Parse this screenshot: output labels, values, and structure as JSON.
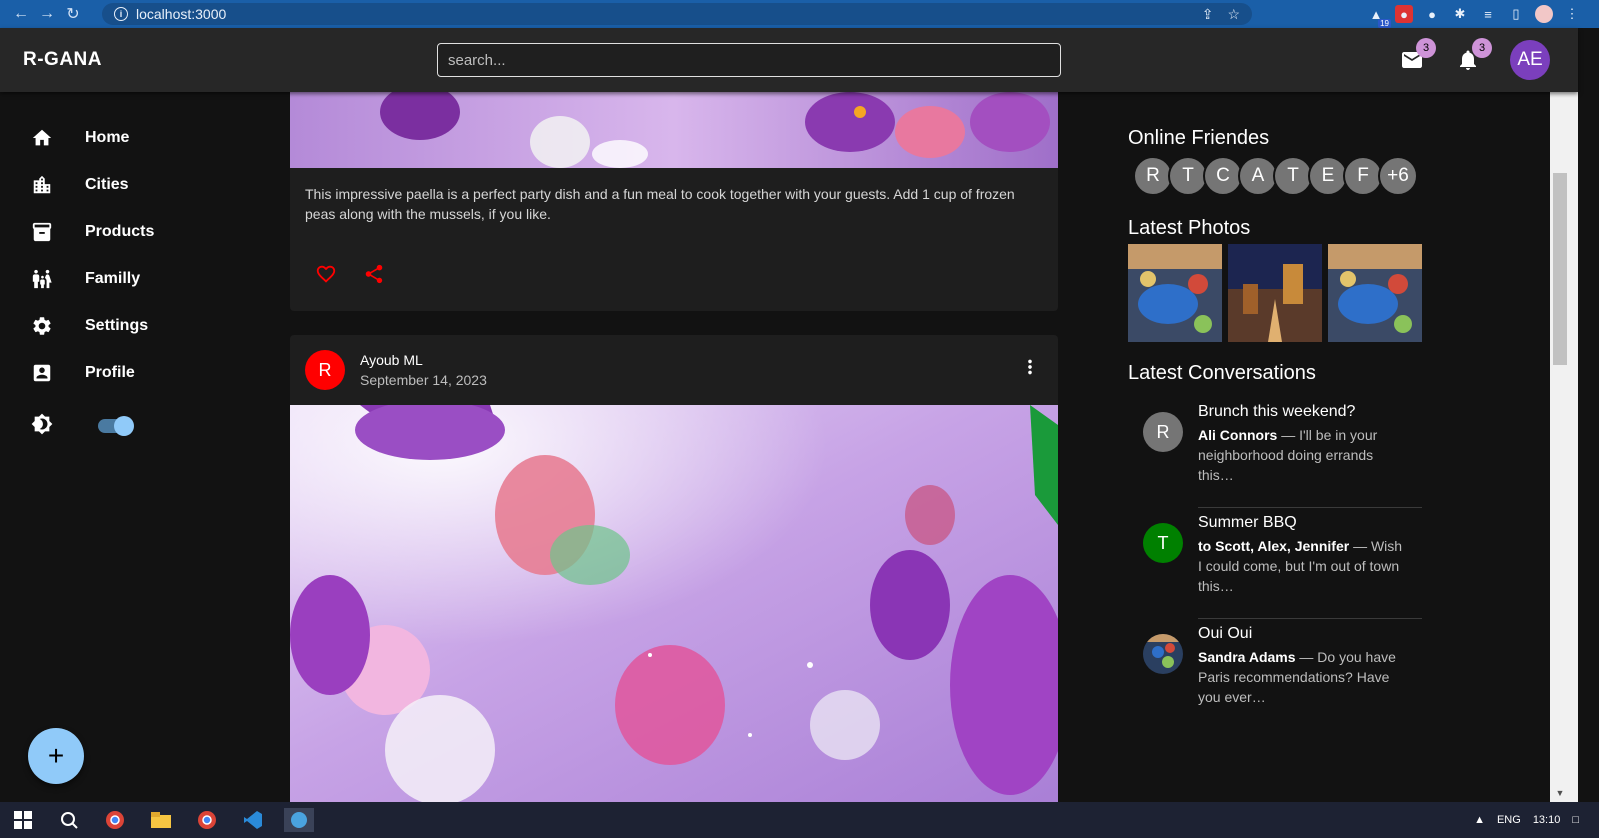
{
  "browser": {
    "url": "localhost:3000",
    "extension_badge": "19"
  },
  "appbar": {
    "brand": "R-GANA",
    "search_placeholder": "search...",
    "mail_badge": "3",
    "notification_badge": "3",
    "user_initials": "AE"
  },
  "sidebar": {
    "items": [
      {
        "label": "Home",
        "icon": "home-icon"
      },
      {
        "label": "Cities",
        "icon": "city-icon"
      },
      {
        "label": "Products",
        "icon": "archive-icon"
      },
      {
        "label": "Familly",
        "icon": "family-icon"
      },
      {
        "label": "Settings",
        "icon": "gear-icon"
      },
      {
        "label": "Profile",
        "icon": "account-box-icon"
      }
    ],
    "dark_mode_on": true,
    "fab_label": "+"
  },
  "feed": {
    "post1": {
      "description": "This impressive paella is a perfect party dish and a fun meal to cook together with your guests. Add 1 cup of frozen peas along with the mussels, if you like."
    },
    "post2": {
      "avatar_initial": "R",
      "author": "Ayoub ML",
      "date": "September 14, 2023"
    }
  },
  "right_panel": {
    "online_title": "Online Friendes",
    "friends": [
      "R",
      "T",
      "C",
      "A",
      "T",
      "E",
      "F",
      "+6"
    ],
    "photos_title": "Latest Photos",
    "conversations_title": "Latest Conversations",
    "conversations": [
      {
        "avatar": "R",
        "avatar_color": "#757575",
        "title": "Brunch this weekend?",
        "from": "Ali Connors",
        "text": " — I'll be in your neighborhood doing errands this…"
      },
      {
        "avatar": "T",
        "avatar_color": "#008000",
        "title": "Summer BBQ",
        "from": "to Scott, Alex, Jennifer",
        "text": " — Wish I could come, but I'm out of town this…"
      },
      {
        "avatar": "",
        "avatar_color": "#2a3f60",
        "title": "Oui Oui",
        "from": "Sandra Adams",
        "text": " — Do you have Paris recommendations? Have you ever…"
      }
    ]
  },
  "taskbar": {
    "time": "13:10",
    "lang": "ENG"
  },
  "colors": {
    "accent": "#90caf9",
    "badge": "#ce93d8",
    "user_avatar": "#7b3fbd",
    "action_red": "#ff0000"
  }
}
